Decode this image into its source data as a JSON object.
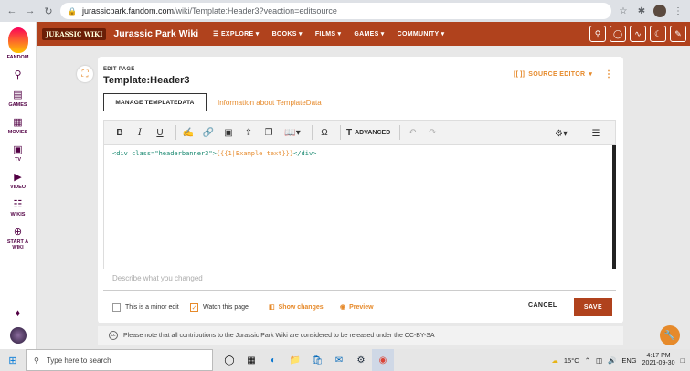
{
  "browser": {
    "url_domain": "jurassicpark.fandom.com",
    "url_path": "/wiki/Template:Header3?veaction=editsource"
  },
  "rail": {
    "brand": "FANDOM",
    "items": [
      {
        "label": "",
        "icon": "search-icon"
      },
      {
        "label": "GAMES",
        "icon": "games-icon"
      },
      {
        "label": "MOVIES",
        "icon": "movies-icon"
      },
      {
        "label": "TV",
        "icon": "tv-icon"
      },
      {
        "label": "VIDEO",
        "icon": "video-icon"
      },
      {
        "label": "WIKIS",
        "icon": "wikis-icon"
      },
      {
        "label": "START A WIKI",
        "icon": "plus-icon"
      }
    ]
  },
  "wiki": {
    "logo": "JURASSIC WIKI",
    "name": "Jurassic Park Wiki",
    "menu": [
      "EXPLORE",
      "BOOKS",
      "FILMS",
      "GAMES",
      "COMMUNITY"
    ]
  },
  "editor": {
    "edit_label": "EDIT PAGE",
    "title": "Template:Header3",
    "source_editor": "SOURCE EDITOR",
    "manage_button": "MANAGE TEMPLATEDATA",
    "info_link": "Information about TemplateData",
    "toolbar": {
      "advanced": "ADVANCED"
    },
    "code": {
      "tag_open": "<div class=\"headerbanner3\">",
      "template": "{{{1|Example text}}}",
      "tag_close": "</div>"
    },
    "summary_placeholder": "Describe what you changed",
    "minor_edit": "This is a minor edit",
    "watch_page": "Watch this page",
    "show_changes": "Show changes",
    "preview": "Preview",
    "cancel": "CANCEL",
    "save": "SAVE",
    "notice": "Please note that all contributions to the Jurassic Park Wiki are considered to be released under the CC-BY-SA"
  },
  "taskbar": {
    "search_placeholder": "Type here to search",
    "temperature": "15°C",
    "lang": "ENG",
    "time": "4:17 PM",
    "date": "2021-09-30"
  }
}
